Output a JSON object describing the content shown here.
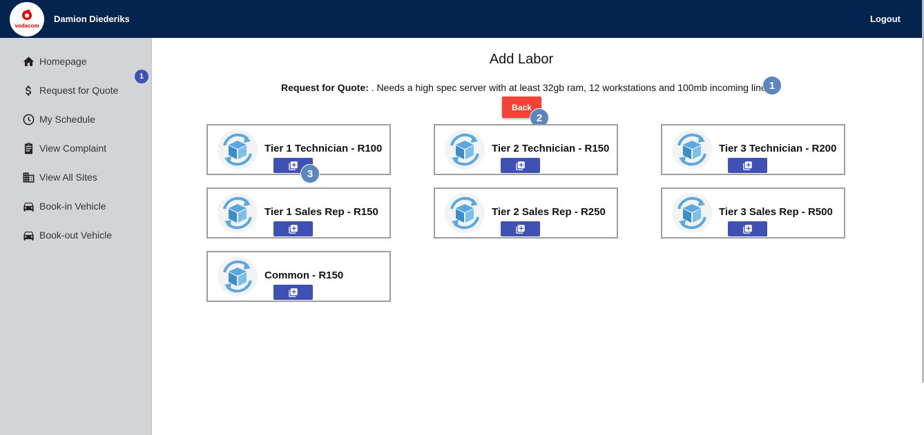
{
  "header": {
    "brand": "vodacom",
    "user_name": "Damion Diederiks",
    "logout_label": "Logout"
  },
  "sidebar": {
    "badge_count": "1",
    "items": [
      {
        "label": "Homepage",
        "icon": "home-icon"
      },
      {
        "label": "Request for Quote",
        "icon": "dollar-icon"
      },
      {
        "label": "My Schedule",
        "icon": "clock-icon"
      },
      {
        "label": "View Complaint",
        "icon": "clipboard-icon"
      },
      {
        "label": "View All Sites",
        "icon": "building-icon"
      },
      {
        "label": "Book-in Vehicle",
        "icon": "car-icon"
      },
      {
        "label": "Book-out Vehicle",
        "icon": "car-icon"
      }
    ]
  },
  "main": {
    "title": "Add Labor",
    "quote_label": "Request for Quote:",
    "quote_text": " . Needs a high spec server with at least 32gb ram, 12 workstations and 100mb incoming line",
    "back_label": "Back",
    "steps": [
      "1",
      "2",
      "3"
    ],
    "cards": [
      {
        "title": "Tier 1 Technician - R100"
      },
      {
        "title": "Tier 2 Technician - R150"
      },
      {
        "title": "Tier 3 Technician - R200"
      },
      {
        "title": "Tier 1 Sales Rep - R150"
      },
      {
        "title": "Tier 2 Sales Rep - R250"
      },
      {
        "title": "Tier 3 Sales Rep - R500"
      },
      {
        "title": "Common - R150"
      }
    ]
  },
  "colors": {
    "header_bg": "#04234f",
    "sidebar_bg": "#d3d4d8",
    "accent": "#3f51b5",
    "back_button": "#f44336",
    "step_marker": "#5b86bf",
    "brand_red": "#e60000"
  }
}
